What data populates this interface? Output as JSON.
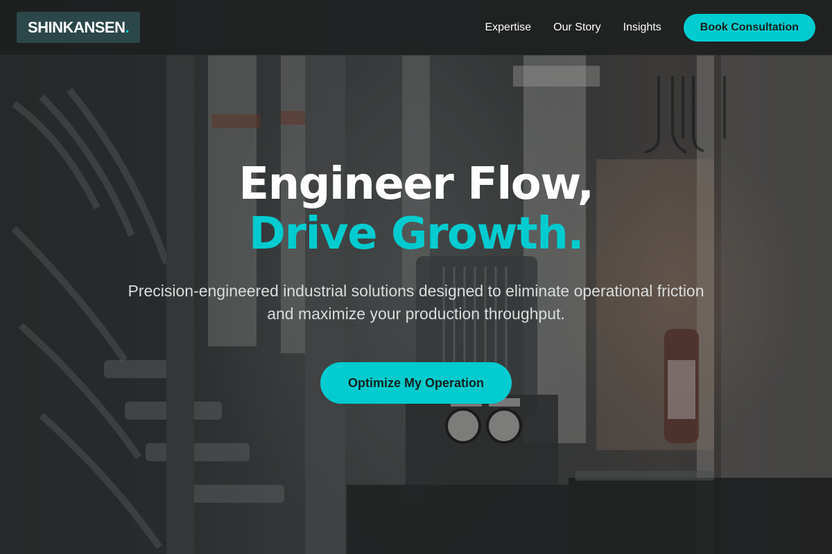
{
  "header": {
    "logo_text": "SHINKANSEN",
    "logo_dot": ".",
    "nav": [
      {
        "label": "Expertise"
      },
      {
        "label": "Our Story"
      },
      {
        "label": "Insights"
      }
    ],
    "cta_label": "Book Consultation"
  },
  "hero": {
    "headline_line1": "Engineer Flow,",
    "headline_line2": "Drive Growth.",
    "subtext": "Precision-engineered industrial solutions designed to eliminate operational friction and maximize your production throughput.",
    "cta_label": "Optimize My Operation",
    "background_image": "industrial-machinery-photo"
  },
  "colors": {
    "accent": "#00cccf",
    "header_bg": "#1e2020",
    "logo_bg": "#2c4749",
    "text_light": "#ffffff"
  }
}
